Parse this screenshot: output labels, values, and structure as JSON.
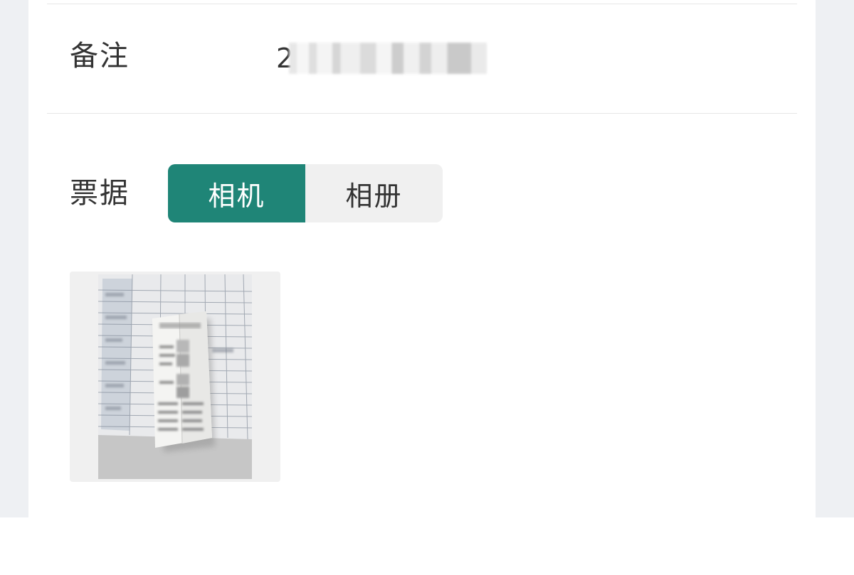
{
  "form": {
    "note": {
      "label": "备注",
      "value_visible": "2"
    },
    "receipt": {
      "label": "票据",
      "source_options": [
        {
          "label": "相机",
          "selected": true
        },
        {
          "label": "相册",
          "selected": false
        }
      ],
      "attachment": {
        "icon": "receipt-photo-thumbnail"
      }
    }
  },
  "colors": {
    "accent": "#1f8577",
    "page_background": "#eef0f3",
    "card_background": "#ffffff",
    "text": "#333333",
    "segment_inactive": "#f0f0f0"
  }
}
